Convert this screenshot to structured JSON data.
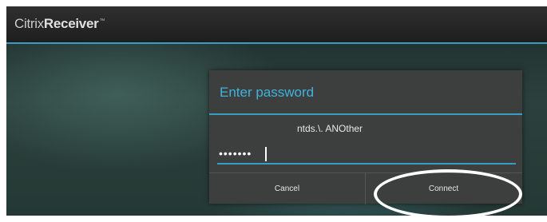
{
  "app": {
    "logo_part1": "Citrix",
    "logo_part2": "Receiver",
    "logo_tm": "™"
  },
  "dialog": {
    "title": "Enter password",
    "username": "ntds.\\. ANOther",
    "password_masked": "•••••••",
    "cancel_label": "Cancel",
    "connect_label": "Connect"
  },
  "colors": {
    "accent": "#3a9ec4",
    "title": "#3fb3dd",
    "dialog_bg": "#3d3f3f",
    "annotation": "#ffffff"
  }
}
